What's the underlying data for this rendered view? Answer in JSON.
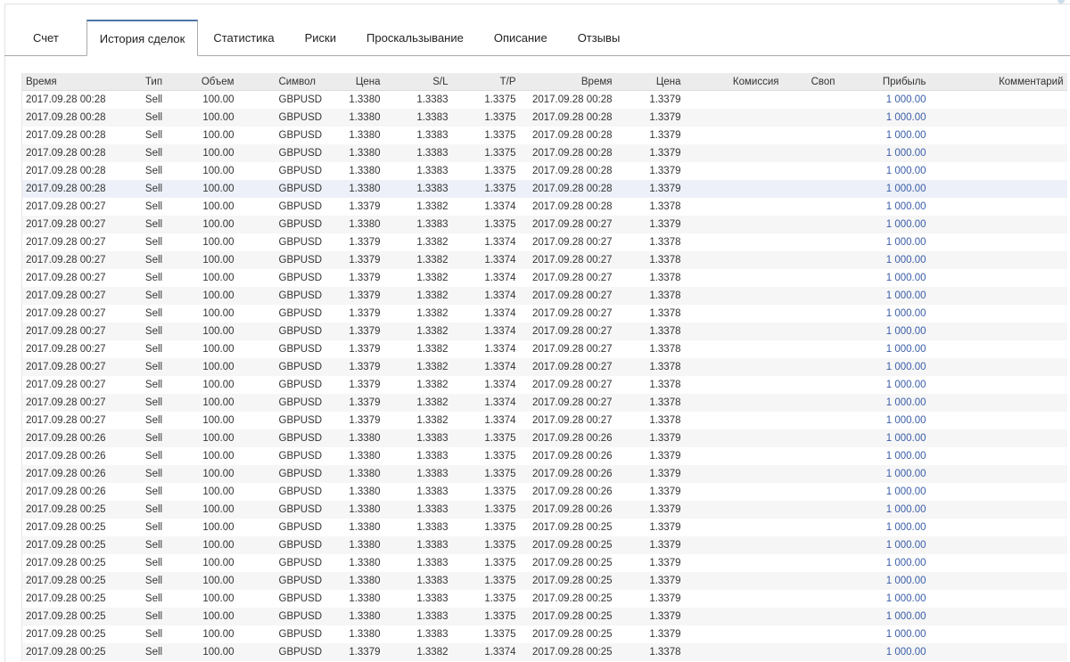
{
  "tabs": [
    {
      "label": "Счет",
      "active": false
    },
    {
      "label": "История сделок",
      "active": true
    },
    {
      "label": "Статистика",
      "active": false
    },
    {
      "label": "Риски",
      "active": false
    },
    {
      "label": "Проскальзывание",
      "active": false
    },
    {
      "label": "Описание",
      "active": false
    },
    {
      "label": "Отзывы",
      "active": false
    }
  ],
  "table": {
    "headers": [
      "Время",
      "Тип",
      "Объем",
      "Символ",
      "Цена",
      "S/L",
      "T/P",
      "Время",
      "Цена",
      "Комиссия",
      "Своп",
      "Прибыль",
      "Комментарий"
    ],
    "highlighted_row": 5,
    "rows": [
      [
        "2017.09.28 00:28",
        "Sell",
        "100.00",
        "GBPUSD",
        "1.3380",
        "1.3383",
        "1.3375",
        "2017.09.28 00:28",
        "1.3379",
        "",
        "",
        "1 000.00",
        ""
      ],
      [
        "2017.09.28 00:28",
        "Sell",
        "100.00",
        "GBPUSD",
        "1.3380",
        "1.3383",
        "1.3375",
        "2017.09.28 00:28",
        "1.3379",
        "",
        "",
        "1 000.00",
        ""
      ],
      [
        "2017.09.28 00:28",
        "Sell",
        "100.00",
        "GBPUSD",
        "1.3380",
        "1.3383",
        "1.3375",
        "2017.09.28 00:28",
        "1.3379",
        "",
        "",
        "1 000.00",
        ""
      ],
      [
        "2017.09.28 00:28",
        "Sell",
        "100.00",
        "GBPUSD",
        "1.3380",
        "1.3383",
        "1.3375",
        "2017.09.28 00:28",
        "1.3379",
        "",
        "",
        "1 000.00",
        ""
      ],
      [
        "2017.09.28 00:28",
        "Sell",
        "100.00",
        "GBPUSD",
        "1.3380",
        "1.3383",
        "1.3375",
        "2017.09.28 00:28",
        "1.3379",
        "",
        "",
        "1 000.00",
        ""
      ],
      [
        "2017.09.28 00:28",
        "Sell",
        "100.00",
        "GBPUSD",
        "1.3380",
        "1.3383",
        "1.3375",
        "2017.09.28 00:28",
        "1.3379",
        "",
        "",
        "1 000.00",
        ""
      ],
      [
        "2017.09.28 00:27",
        "Sell",
        "100.00",
        "GBPUSD",
        "1.3379",
        "1.3382",
        "1.3374",
        "2017.09.28 00:28",
        "1.3378",
        "",
        "",
        "1 000.00",
        ""
      ],
      [
        "2017.09.28 00:27",
        "Sell",
        "100.00",
        "GBPUSD",
        "1.3380",
        "1.3383",
        "1.3375",
        "2017.09.28 00:27",
        "1.3379",
        "",
        "",
        "1 000.00",
        ""
      ],
      [
        "2017.09.28 00:27",
        "Sell",
        "100.00",
        "GBPUSD",
        "1.3379",
        "1.3382",
        "1.3374",
        "2017.09.28 00:27",
        "1.3378",
        "",
        "",
        "1 000.00",
        ""
      ],
      [
        "2017.09.28 00:27",
        "Sell",
        "100.00",
        "GBPUSD",
        "1.3379",
        "1.3382",
        "1.3374",
        "2017.09.28 00:27",
        "1.3378",
        "",
        "",
        "1 000.00",
        ""
      ],
      [
        "2017.09.28 00:27",
        "Sell",
        "100.00",
        "GBPUSD",
        "1.3379",
        "1.3382",
        "1.3374",
        "2017.09.28 00:27",
        "1.3378",
        "",
        "",
        "1 000.00",
        ""
      ],
      [
        "2017.09.28 00:27",
        "Sell",
        "100.00",
        "GBPUSD",
        "1.3379",
        "1.3382",
        "1.3374",
        "2017.09.28 00:27",
        "1.3378",
        "",
        "",
        "1 000.00",
        ""
      ],
      [
        "2017.09.28 00:27",
        "Sell",
        "100.00",
        "GBPUSD",
        "1.3379",
        "1.3382",
        "1.3374",
        "2017.09.28 00:27",
        "1.3378",
        "",
        "",
        "1 000.00",
        ""
      ],
      [
        "2017.09.28 00:27",
        "Sell",
        "100.00",
        "GBPUSD",
        "1.3379",
        "1.3382",
        "1.3374",
        "2017.09.28 00:27",
        "1.3378",
        "",
        "",
        "1 000.00",
        ""
      ],
      [
        "2017.09.28 00:27",
        "Sell",
        "100.00",
        "GBPUSD",
        "1.3379",
        "1.3382",
        "1.3374",
        "2017.09.28 00:27",
        "1.3378",
        "",
        "",
        "1 000.00",
        ""
      ],
      [
        "2017.09.28 00:27",
        "Sell",
        "100.00",
        "GBPUSD",
        "1.3379",
        "1.3382",
        "1.3374",
        "2017.09.28 00:27",
        "1.3378",
        "",
        "",
        "1 000.00",
        ""
      ],
      [
        "2017.09.28 00:27",
        "Sell",
        "100.00",
        "GBPUSD",
        "1.3379",
        "1.3382",
        "1.3374",
        "2017.09.28 00:27",
        "1.3378",
        "",
        "",
        "1 000.00",
        ""
      ],
      [
        "2017.09.28 00:27",
        "Sell",
        "100.00",
        "GBPUSD",
        "1.3379",
        "1.3382",
        "1.3374",
        "2017.09.28 00:27",
        "1.3378",
        "",
        "",
        "1 000.00",
        ""
      ],
      [
        "2017.09.28 00:27",
        "Sell",
        "100.00",
        "GBPUSD",
        "1.3379",
        "1.3382",
        "1.3374",
        "2017.09.28 00:27",
        "1.3378",
        "",
        "",
        "1 000.00",
        ""
      ],
      [
        "2017.09.28 00:26",
        "Sell",
        "100.00",
        "GBPUSD",
        "1.3380",
        "1.3383",
        "1.3375",
        "2017.09.28 00:26",
        "1.3379",
        "",
        "",
        "1 000.00",
        ""
      ],
      [
        "2017.09.28 00:26",
        "Sell",
        "100.00",
        "GBPUSD",
        "1.3380",
        "1.3383",
        "1.3375",
        "2017.09.28 00:26",
        "1.3379",
        "",
        "",
        "1 000.00",
        ""
      ],
      [
        "2017.09.28 00:26",
        "Sell",
        "100.00",
        "GBPUSD",
        "1.3380",
        "1.3383",
        "1.3375",
        "2017.09.28 00:26",
        "1.3379",
        "",
        "",
        "1 000.00",
        ""
      ],
      [
        "2017.09.28 00:26",
        "Sell",
        "100.00",
        "GBPUSD",
        "1.3380",
        "1.3383",
        "1.3375",
        "2017.09.28 00:26",
        "1.3379",
        "",
        "",
        "1 000.00",
        ""
      ],
      [
        "2017.09.28 00:25",
        "Sell",
        "100.00",
        "GBPUSD",
        "1.3380",
        "1.3383",
        "1.3375",
        "2017.09.28 00:26",
        "1.3379",
        "",
        "",
        "1 000.00",
        ""
      ],
      [
        "2017.09.28 00:25",
        "Sell",
        "100.00",
        "GBPUSD",
        "1.3380",
        "1.3383",
        "1.3375",
        "2017.09.28 00:25",
        "1.3379",
        "",
        "",
        "1 000.00",
        ""
      ],
      [
        "2017.09.28 00:25",
        "Sell",
        "100.00",
        "GBPUSD",
        "1.3380",
        "1.3383",
        "1.3375",
        "2017.09.28 00:25",
        "1.3379",
        "",
        "",
        "1 000.00",
        ""
      ],
      [
        "2017.09.28 00:25",
        "Sell",
        "100.00",
        "GBPUSD",
        "1.3380",
        "1.3383",
        "1.3375",
        "2017.09.28 00:25",
        "1.3379",
        "",
        "",
        "1 000.00",
        ""
      ],
      [
        "2017.09.28 00:25",
        "Sell",
        "100.00",
        "GBPUSD",
        "1.3380",
        "1.3383",
        "1.3375",
        "2017.09.28 00:25",
        "1.3379",
        "",
        "",
        "1 000.00",
        ""
      ],
      [
        "2017.09.28 00:25",
        "Sell",
        "100.00",
        "GBPUSD",
        "1.3380",
        "1.3383",
        "1.3375",
        "2017.09.28 00:25",
        "1.3379",
        "",
        "",
        "1 000.00",
        ""
      ],
      [
        "2017.09.28 00:25",
        "Sell",
        "100.00",
        "GBPUSD",
        "1.3380",
        "1.3383",
        "1.3375",
        "2017.09.28 00:25",
        "1.3379",
        "",
        "",
        "1 000.00",
        ""
      ],
      [
        "2017.09.28 00:25",
        "Sell",
        "100.00",
        "GBPUSD",
        "1.3380",
        "1.3383",
        "1.3375",
        "2017.09.28 00:25",
        "1.3379",
        "",
        "",
        "1 000.00",
        ""
      ],
      [
        "2017.09.28 00:25",
        "Sell",
        "100.00",
        "GBPUSD",
        "1.3379",
        "1.3382",
        "1.3374",
        "2017.09.28 00:25",
        "1.3378",
        "",
        "",
        "1 000.00",
        ""
      ]
    ]
  },
  "colors": {
    "accent": "#4f74a8",
    "profit": "#3a5ea8",
    "header_bg": "#ececec"
  }
}
